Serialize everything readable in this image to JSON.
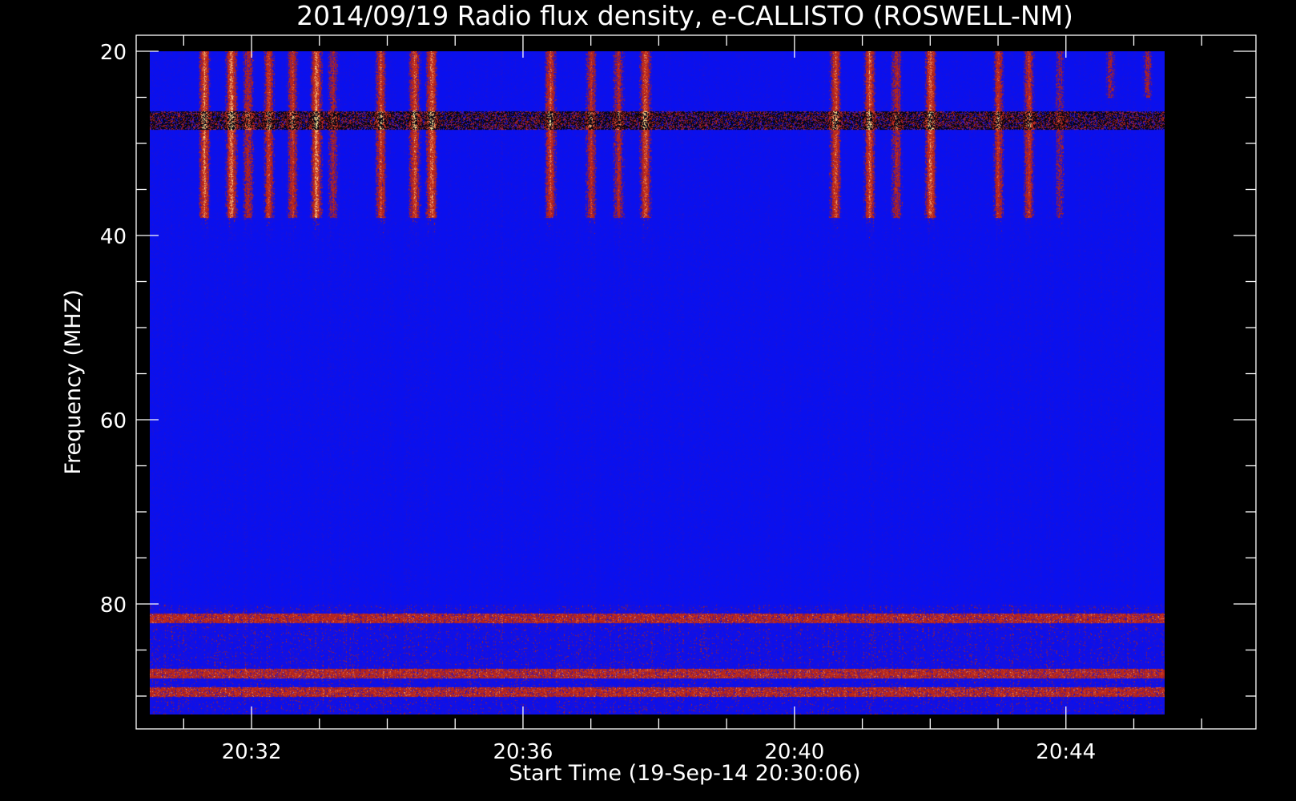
{
  "chart_data": {
    "type": "heatmap",
    "title": "2014/09/19  Radio flux density, e-CALLISTO (ROSWELL-NM)",
    "xlabel": "Start Time (19-Sep-14 20:30:06)",
    "ylabel": "Frequency (MHZ)",
    "x_unit": "minutes",
    "x_ticks": [
      {
        "label": "20:32",
        "minute": 32
      },
      {
        "label": "20:36",
        "minute": 36
      },
      {
        "label": "20:40",
        "minute": 40
      },
      {
        "label": "20:44",
        "minute": 44
      }
    ],
    "xlim": [
      30.3,
      46.8
    ],
    "data_xlim": [
      30.5,
      45.45
    ],
    "y_ticks": [
      20,
      40,
      60,
      80
    ],
    "ylim": [
      20,
      92
    ],
    "y_inverted": true,
    "colors": {
      "background": "#000000",
      "low": "#0a10ee",
      "mid": "#d0321a",
      "high": "#fff3a0",
      "dark": "#000000"
    },
    "bursts": [
      {
        "minute": 31.3,
        "fmin": 20,
        "fmax": 38,
        "intensity": 0.95
      },
      {
        "minute": 31.7,
        "fmin": 20,
        "fmax": 38,
        "intensity": 1.0
      },
      {
        "minute": 31.95,
        "fmin": 20,
        "fmax": 38,
        "intensity": 0.6
      },
      {
        "minute": 32.25,
        "fmin": 20,
        "fmax": 38,
        "intensity": 0.75
      },
      {
        "minute": 32.6,
        "fmin": 20,
        "fmax": 38,
        "intensity": 0.7
      },
      {
        "minute": 32.95,
        "fmin": 20,
        "fmax": 38,
        "intensity": 1.0
      },
      {
        "minute": 33.2,
        "fmin": 20,
        "fmax": 38,
        "intensity": 0.5
      },
      {
        "minute": 33.9,
        "fmin": 20,
        "fmax": 38,
        "intensity": 0.8
      },
      {
        "minute": 34.4,
        "fmin": 20,
        "fmax": 38,
        "intensity": 0.85
      },
      {
        "minute": 34.65,
        "fmin": 20,
        "fmax": 38,
        "intensity": 0.95
      },
      {
        "minute": 36.4,
        "fmin": 20,
        "fmax": 38,
        "intensity": 0.85
      },
      {
        "minute": 37.0,
        "fmin": 20,
        "fmax": 38,
        "intensity": 0.65
      },
      {
        "minute": 37.4,
        "fmin": 20,
        "fmax": 38,
        "intensity": 0.6
      },
      {
        "minute": 37.8,
        "fmin": 20,
        "fmax": 38,
        "intensity": 0.85
      },
      {
        "minute": 40.6,
        "fmin": 20,
        "fmax": 38,
        "intensity": 0.85
      },
      {
        "minute": 41.1,
        "fmin": 20,
        "fmax": 38,
        "intensity": 0.85
      },
      {
        "minute": 41.5,
        "fmin": 20,
        "fmax": 38,
        "intensity": 0.6
      },
      {
        "minute": 42.0,
        "fmin": 20,
        "fmax": 38,
        "intensity": 0.95
      },
      {
        "minute": 43.0,
        "fmin": 20,
        "fmax": 38,
        "intensity": 0.7
      },
      {
        "minute": 43.45,
        "fmin": 20,
        "fmax": 38,
        "intensity": 0.7
      },
      {
        "minute": 43.9,
        "fmin": 20,
        "fmax": 38,
        "intensity": 0.45
      },
      {
        "minute": 44.65,
        "fmin": 20,
        "fmax": 25,
        "intensity": 0.45
      },
      {
        "minute": 45.2,
        "fmin": 20,
        "fmax": 25,
        "intensity": 0.5
      }
    ],
    "interference_bands": [
      {
        "fmin": 26.5,
        "fmax": 28.5,
        "kind": "dark"
      },
      {
        "fmin": 81,
        "fmax": 82,
        "kind": "red"
      },
      {
        "fmin": 87,
        "fmax": 88,
        "kind": "red"
      },
      {
        "fmin": 89,
        "fmax": 90,
        "kind": "red"
      }
    ]
  }
}
